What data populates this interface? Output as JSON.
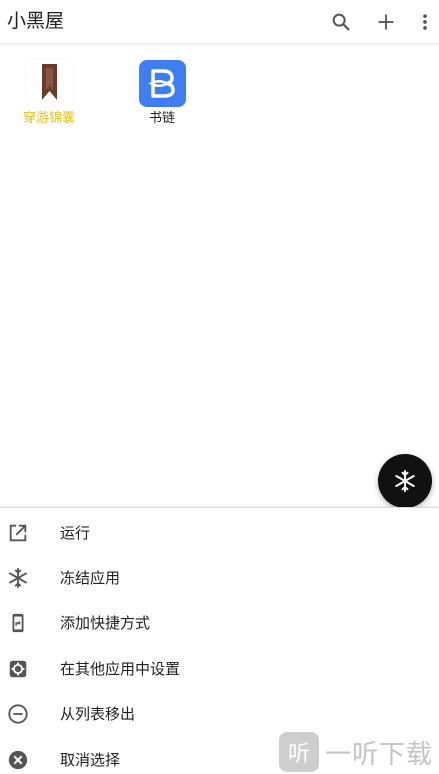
{
  "header": {
    "title": "小黑屋",
    "search_icon": "search-icon",
    "add_icon": "plus-icon",
    "more_icon": "more-vertical-icon"
  },
  "apps": [
    {
      "label": "穿游锦囊",
      "icon": "bookmark-app-icon",
      "label_color": "#e6c21f",
      "selected": true
    },
    {
      "label": "书链",
      "icon": "shulian-app-icon",
      "label_color": "#222222",
      "selected": false
    }
  ],
  "fab": {
    "icon": "snowflake-icon"
  },
  "menu": [
    {
      "label": "运行",
      "icon": "open-external-icon"
    },
    {
      "label": "冻结应用",
      "icon": "snowflake-icon"
    },
    {
      "label": "添加快捷方式",
      "icon": "shortcut-icon"
    },
    {
      "label": "在其他应用中设置",
      "icon": "settings-icon"
    },
    {
      "label": "从列表移出",
      "icon": "remove-circle-icon"
    },
    {
      "label": "取消选择",
      "icon": "cancel-circle-icon"
    }
  ],
  "watermark": {
    "text": "一听下载",
    "badge": "听"
  },
  "colors": {
    "accent": "#3e7df2",
    "selected_label": "#e6c21f",
    "icon_gray": "#555555"
  }
}
